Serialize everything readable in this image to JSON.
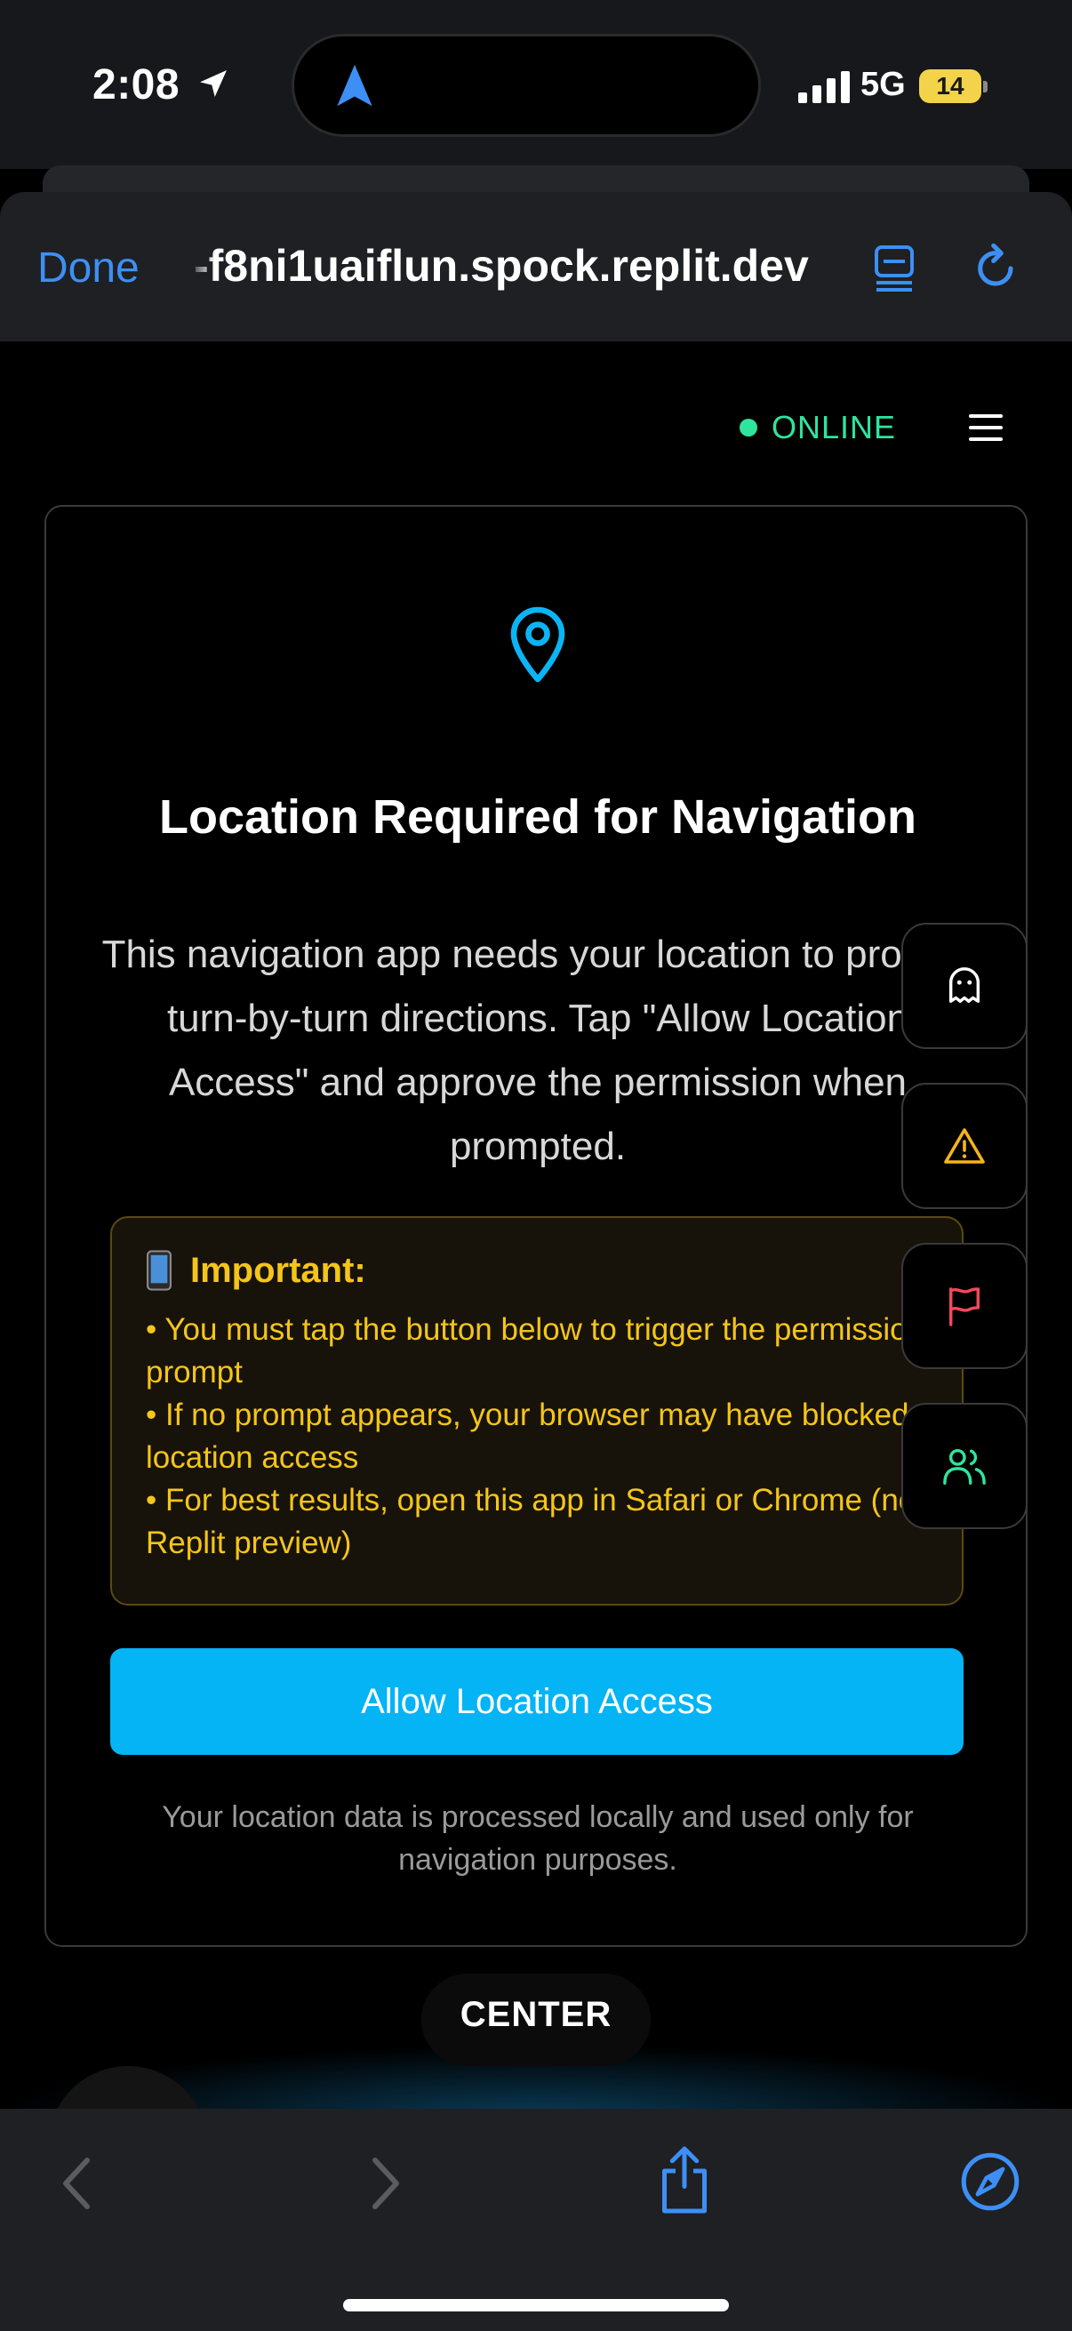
{
  "status_bar": {
    "time": "2:08",
    "network": "5G",
    "battery": "14"
  },
  "browser": {
    "done_label": "Done",
    "url": "-f8ni1uaiflun.spock.replit.dev",
    "accent": "#3d8ff5"
  },
  "app_header": {
    "status": "ONLINE",
    "status_color": "#2ee59d"
  },
  "card": {
    "title": "Location Required for Navigation",
    "description": "This navigation app needs your location to provide turn-by-turn directions. Tap \"Allow Location Access\" and approve the permission when prompted.",
    "important": {
      "heading": "Important:",
      "lines": [
        "• You must tap the button below to trigger the permission prompt",
        "• If no prompt appears, your browser may have blocked location access",
        "• For best results, open this app in Safari or Chrome (not Replit preview)"
      ]
    },
    "allow_button": "Allow Location Access",
    "privacy_note": "Your location data is processed locally and used only for navigation purposes."
  },
  "floating_actions": [
    {
      "icon": "ghost-icon"
    },
    {
      "icon": "warning-icon"
    },
    {
      "icon": "flag-icon"
    },
    {
      "icon": "users-icon"
    }
  ],
  "center_label": "CENTER",
  "toolbar": {
    "icons": [
      "back-icon",
      "forward-icon",
      "share-icon",
      "compass-icon"
    ]
  }
}
